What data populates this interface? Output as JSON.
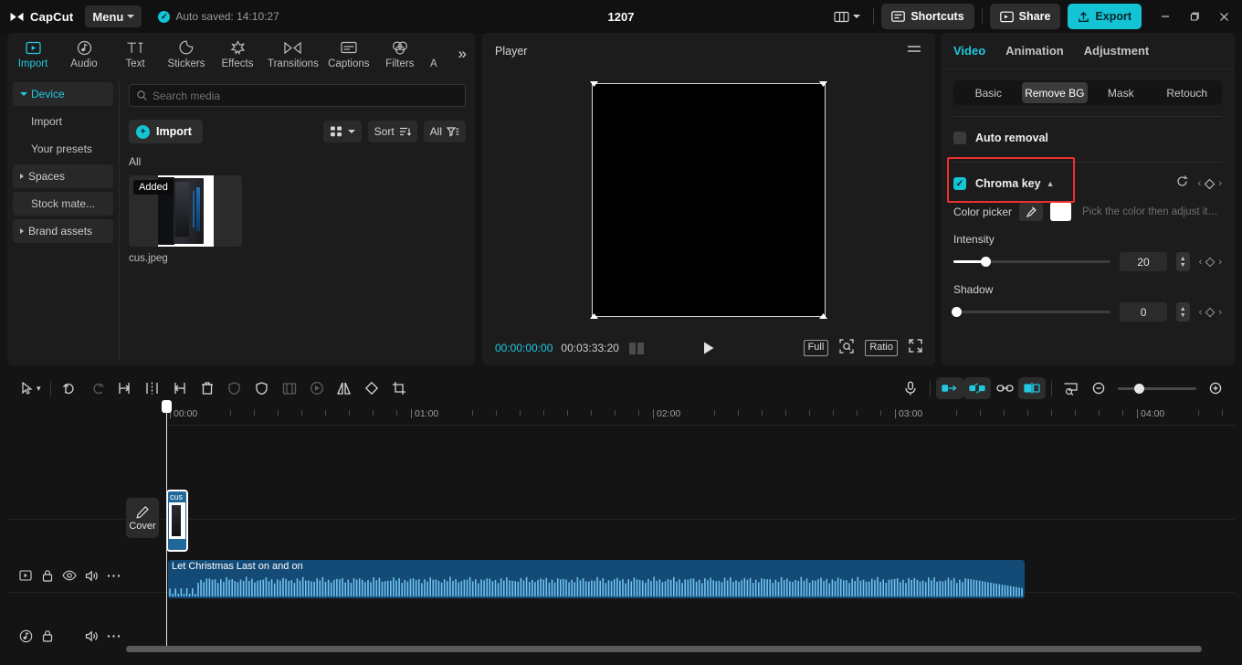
{
  "titlebar": {
    "brand": "CapCut",
    "menu_label": "Menu",
    "autosave_text": "Auto saved: 14:10:27",
    "project_title": "1207",
    "shortcuts_label": "Shortcuts",
    "share_label": "Share",
    "export_label": "Export",
    "accent_color": "#14c3d4"
  },
  "nav_tabs": [
    {
      "label": "Import",
      "icon": "import-icon",
      "active": true
    },
    {
      "label": "Audio",
      "icon": "audio-note-icon",
      "active": false
    },
    {
      "label": "Text",
      "icon": "text-icon",
      "active": false
    },
    {
      "label": "Stickers",
      "icon": "sticker-icon",
      "active": false
    },
    {
      "label": "Effects",
      "icon": "effects-star-icon",
      "active": false
    },
    {
      "label": "Transitions",
      "icon": "transitions-icon",
      "active": false
    },
    {
      "label": "Captions",
      "icon": "captions-icon",
      "active": false
    },
    {
      "label": "Filters",
      "icon": "filters-icon",
      "active": false
    },
    {
      "label": "A",
      "icon": "adjustment-icon",
      "active": false
    }
  ],
  "nav_more": "»",
  "left_nav": [
    {
      "label": "Device",
      "active": true,
      "boxed": true,
      "expander": "open",
      "sub": false
    },
    {
      "label": "Import",
      "active": false,
      "boxed": false,
      "expander": "none",
      "sub": true
    },
    {
      "label": "Your presets",
      "active": false,
      "boxed": false,
      "expander": "none",
      "sub": true
    },
    {
      "label": "Spaces",
      "active": false,
      "boxed": true,
      "expander": "closed",
      "sub": false
    },
    {
      "label": "Stock mate...",
      "active": false,
      "boxed": true,
      "expander": "none",
      "sub": true
    },
    {
      "label": "Brand assets",
      "active": false,
      "boxed": true,
      "expander": "closed",
      "sub": false
    }
  ],
  "media": {
    "search_placeholder": "Search media",
    "search_value": "",
    "import_label": "Import",
    "grid_icon": "grid-view-icon",
    "sort_label": "Sort",
    "filter_label": "All",
    "section_label": "All",
    "items": [
      {
        "name": "cus.jpeg",
        "badge": "Added",
        "thumb": "pc-case-photo"
      }
    ]
  },
  "player": {
    "title": "Player",
    "menu_icon": "hamburger-icon",
    "current_time": "00:00:00:00",
    "total_time": "00:03:33:20",
    "play_icon": "play-triangle-icon",
    "full_label": "Full",
    "ratio_label": "Ratio",
    "zoom_icon": "zoom-focus-icon",
    "fullscreen_icon": "expand-icon"
  },
  "right_panel": {
    "tabs": [
      {
        "label": "Video",
        "active": true
      },
      {
        "label": "Animation",
        "active": false
      },
      {
        "label": "Adjustment",
        "active": false
      }
    ],
    "segments": [
      {
        "label": "Basic",
        "active": false
      },
      {
        "label": "Remove BG",
        "active": true
      },
      {
        "label": "Mask",
        "active": false
      },
      {
        "label": "Retouch",
        "active": false
      }
    ],
    "auto_removal": {
      "label": "Auto removal",
      "checked": false
    },
    "chroma_key": {
      "label": "Chroma key",
      "checked": true,
      "collapsed": false,
      "highlight_color": "#ee2f2f",
      "reset_icon": "reset-icon",
      "keyframe_icon": "keyframe-diamond-icon"
    },
    "color_picker": {
      "label": "Color picker",
      "eyedropper_icon": "eyedropper-icon",
      "swatch_color": "#ffffff",
      "hint": "Pick the color then adjust its i..."
    },
    "sliders": [
      {
        "label": "Intensity",
        "value": "20",
        "percent": 20
      },
      {
        "label": "Shadow",
        "value": "0",
        "percent": 0
      }
    ]
  },
  "timeline": {
    "toolbar_left": [
      {
        "icon": "select-arrow-icon",
        "name": "select-tool",
        "dim": false
      },
      {
        "icon": "chevron-down-icon",
        "name": "tool-dropdown",
        "dim": false
      },
      {
        "icon": "undo-icon",
        "name": "undo-button",
        "dim": false
      },
      {
        "icon": "redo-icon",
        "name": "redo-button",
        "dim": true
      },
      {
        "icon": "split-left-icon",
        "name": "split-left-button",
        "dim": false
      },
      {
        "icon": "split-icon",
        "name": "split-button",
        "dim": false
      },
      {
        "icon": "split-right-icon",
        "name": "split-right-button",
        "dim": false
      },
      {
        "icon": "delete-icon",
        "name": "delete-button",
        "dim": false
      },
      {
        "icon": "ai-shield-icon",
        "name": "ai-tool-button",
        "dim": true
      },
      {
        "icon": "shield-icon",
        "name": "shield-button",
        "dim": false
      },
      {
        "icon": "freeze-frame-icon",
        "name": "freeze-frame-button",
        "dim": true
      },
      {
        "icon": "reverse-icon",
        "name": "reverse-button",
        "dim": true
      },
      {
        "icon": "mirror-icon",
        "name": "mirror-button",
        "dim": false
      },
      {
        "icon": "rotate-icon",
        "name": "rotate-button",
        "dim": false
      },
      {
        "icon": "crop-icon",
        "name": "crop-button",
        "dim": false
      }
    ],
    "toolbar_right": [
      {
        "icon": "mic-icon",
        "name": "record-voiceover-button",
        "chip": false,
        "on": false
      },
      {
        "icon": "auto-fit-icon",
        "name": "auto-fit-button",
        "chip": true,
        "on": true
      },
      {
        "icon": "magnet-icon",
        "name": "snap-toggle-button",
        "chip": true,
        "on": true
      },
      {
        "icon": "link-icon",
        "name": "link-clips-button",
        "chip": false,
        "on": false
      },
      {
        "icon": "split-view-icon",
        "name": "split-view-button",
        "chip": true,
        "on": true
      },
      {
        "icon": "thumbnail-preview-icon",
        "name": "thumbnail-preview-button",
        "chip": false,
        "on": false
      },
      {
        "icon": "zoom-out-icon",
        "name": "zoom-out-button",
        "chip": false,
        "on": false
      },
      {
        "icon": "zoom-in-icon",
        "name": "zoom-in-button",
        "chip": false,
        "on": false
      }
    ],
    "ruler_labels": [
      "00:00",
      "01:00",
      "02:00",
      "03:00",
      "04:00"
    ],
    "cover_label": "Cover",
    "video_clip": {
      "label": "cus",
      "name": "video-clip"
    },
    "audio_clip": {
      "label": "Let Christmas Last on and on",
      "name": "audio-clip"
    },
    "video_track_controls": [
      "video-thumb-toggle",
      "lock-icon",
      "eye-icon",
      "volume-icon",
      "more-icon"
    ],
    "audio_track_controls": [
      "audio-icon",
      "lock-icon",
      "volume-icon",
      "more-icon"
    ]
  }
}
